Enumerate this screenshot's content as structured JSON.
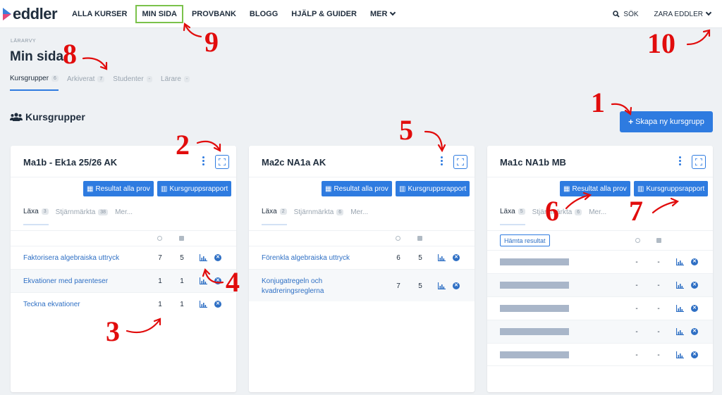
{
  "nav": {
    "logo": "eddler",
    "items": [
      {
        "label": "ALLA KURSER",
        "active": false
      },
      {
        "label": "MIN SIDA",
        "active": true
      },
      {
        "label": "PROVBANK",
        "active": false
      },
      {
        "label": "BLOGG",
        "active": false
      },
      {
        "label": "HJÄLP & GUIDER",
        "active": false
      },
      {
        "label": "MER",
        "active": false
      }
    ],
    "search": "SÖK",
    "user": "ZARA EDDLER"
  },
  "header": {
    "breadcrumb": "LÄRARVY",
    "title": "Min sida",
    "tabs": [
      {
        "label": "Kursgrupper",
        "count": "6"
      },
      {
        "label": "Arkiverat",
        "count": "7"
      },
      {
        "label": "Studenter",
        "count": "-"
      },
      {
        "label": "Lärare",
        "count": "-"
      }
    ]
  },
  "section": {
    "title": "Kursgrupper",
    "create_button": "Skapa ny kursgrupp"
  },
  "labels": {
    "results_all": "Resultat alla prov",
    "group_report": "Kursgruppsrapport",
    "fetch_results": "Hämta resultat",
    "more": "Mer..."
  },
  "cards": [
    {
      "title": "Ma1b - Ek1a 25/26 AK",
      "tabs": [
        {
          "label": "Läxa",
          "count": "3"
        },
        {
          "label": "Stjärnmärkta",
          "count": "38"
        }
      ],
      "rows": [
        {
          "name": "Faktorisera algebraiska uttryck",
          "a": "7",
          "b": "5"
        },
        {
          "name": "Ekvationer med parenteser",
          "a": "1",
          "b": "1"
        },
        {
          "name": "Teckna ekvationer",
          "a": "1",
          "b": "1"
        }
      ]
    },
    {
      "title": "Ma2c NA1a AK",
      "tabs": [
        {
          "label": "Läxa",
          "count": "2"
        },
        {
          "label": "Stjärnmärkta",
          "count": "6"
        }
      ],
      "rows": [
        {
          "name": "Förenkla algebraiska uttryck",
          "a": "6",
          "b": "5"
        },
        {
          "name": "Konjugatregeln och",
          "name2": "kvadreringsreglerna",
          "a": "7",
          "b": "5"
        }
      ]
    },
    {
      "title": "Ma1c NA1b MB",
      "tabs": [
        {
          "label": "Läxa",
          "count": "5"
        },
        {
          "label": "Stjärnmärkta",
          "count": "6"
        }
      ],
      "rows": [
        {
          "a": "-",
          "b": "-"
        },
        {
          "a": "-",
          "b": "-"
        },
        {
          "a": "-",
          "b": "-"
        },
        {
          "a": "-",
          "b": "-"
        },
        {
          "a": "-",
          "b": "-"
        }
      ]
    }
  ],
  "annotations": [
    "1",
    "2",
    "3",
    "4",
    "5",
    "6",
    "7",
    "8",
    "9",
    "10"
  ],
  "colors": {
    "accent": "#2e7be0",
    "annotation": "#e10c0c",
    "active_outline": "#7bc24b"
  }
}
